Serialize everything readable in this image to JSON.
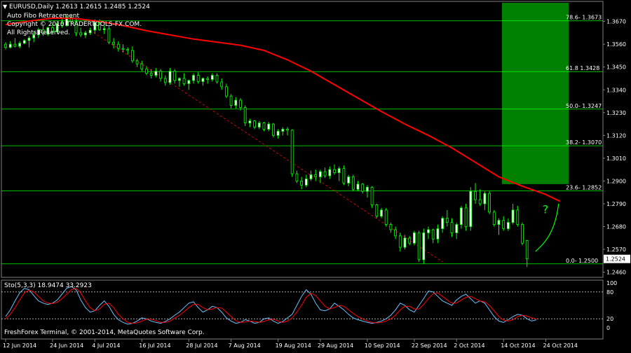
{
  "header": {
    "symbol_line": "EURUSD,Daily  1.2613 1.2615 1.2485 1.2524",
    "indicator": "Auto Fibo Retracement",
    "copyright": "Copyright © 2010 TRADERTOOLS-FX.COM.",
    "rights": "All Rights Reserved."
  },
  "footer": {
    "text": "FreshForex Terminal, © 2001-2014, MetaQuotes Software Corp."
  },
  "colors": {
    "bg": "#000000",
    "bull": "#ffffff",
    "bear": "#00ff00",
    "ma": "#ff0000",
    "fibo": "#00ff00",
    "zone": "#008000",
    "trend": "#ff0000",
    "sto_main": "#6cc3ff",
    "sto_signal": "#ff0000",
    "grid_text": "#ffffff"
  },
  "chart_data": [
    {
      "type": "candlestick",
      "title": "EURUSD,Daily",
      "ohlc_header": [
        1.2613,
        1.2615,
        1.2485,
        1.2524
      ],
      "ylim": [
        1.2435,
        1.376
      ],
      "y_ticks": [
        "1.3670",
        "1.3560",
        "1.3450",
        "1.3340",
        "1.3230",
        "1.3120",
        "1.3010",
        "1.2900",
        "1.2790",
        "1.2680",
        "1.2570",
        "1.2460"
      ],
      "x_tick_labels": [
        "12 Jun 2014",
        "24 Jun 2014",
        "4 Jul 2014",
        "16 Jul 2014",
        "28 Jul 2014",
        "7 Aug 2014",
        "19 Aug 2014",
        "29 Aug 2014",
        "10 Sep 2014",
        "22 Sep 2014",
        "2 Oct 2014",
        "14 Oct 2014",
        "24 Oct 2014"
      ],
      "x_tick_index": [
        0,
        10,
        19,
        29,
        39,
        48,
        58,
        67,
        77,
        87,
        96,
        106,
        115
      ],
      "current_price": "1.2524",
      "candles": [
        [
          1.356,
          1.357,
          1.3535,
          1.3545
        ],
        [
          1.3545,
          1.3575,
          1.354,
          1.356
        ],
        [
          1.356,
          1.359,
          1.3545,
          1.355
        ],
        [
          1.355,
          1.3575,
          1.354,
          1.3565
        ],
        [
          1.3565,
          1.3585,
          1.356,
          1.3578
        ],
        [
          1.3578,
          1.36,
          1.3545,
          1.359
        ],
        [
          1.359,
          1.362,
          1.357,
          1.3605
        ],
        [
          1.3605,
          1.364,
          1.359,
          1.363
        ],
        [
          1.363,
          1.365,
          1.36,
          1.361
        ],
        [
          1.361,
          1.3645,
          1.36,
          1.364
        ],
        [
          1.364,
          1.366,
          1.361,
          1.362
        ],
        [
          1.362,
          1.367,
          1.361,
          1.366
        ],
        [
          1.366,
          1.369,
          1.364,
          1.365
        ],
        [
          1.365,
          1.37,
          1.3645,
          1.369
        ],
        [
          1.369,
          1.37,
          1.366,
          1.367
        ],
        [
          1.367,
          1.368,
          1.36,
          1.3615
        ],
        [
          1.3615,
          1.364,
          1.3595,
          1.3605
        ],
        [
          1.3605,
          1.3625,
          1.359,
          1.3615
        ],
        [
          1.3615,
          1.364,
          1.3605,
          1.3628
        ],
        [
          1.3628,
          1.368,
          1.361,
          1.3665
        ],
        [
          1.3665,
          1.368,
          1.3625,
          1.363
        ],
        [
          1.363,
          1.365,
          1.361,
          1.3635
        ],
        [
          1.3635,
          1.365,
          1.356,
          1.357
        ],
        [
          1.357,
          1.359,
          1.354,
          1.356
        ],
        [
          1.356,
          1.3575,
          1.3525,
          1.354
        ],
        [
          1.354,
          1.356,
          1.352,
          1.3535
        ],
        [
          1.3535,
          1.3545,
          1.351,
          1.353
        ],
        [
          1.353,
          1.355,
          1.347,
          1.348
        ],
        [
          1.348,
          1.349,
          1.345,
          1.3465
        ],
        [
          1.3465,
          1.348,
          1.343,
          1.344
        ],
        [
          1.344,
          1.3455,
          1.341,
          1.342
        ],
        [
          1.342,
          1.344,
          1.3395,
          1.341
        ],
        [
          1.341,
          1.3445,
          1.34,
          1.343
        ],
        [
          1.343,
          1.344,
          1.338,
          1.3395
        ],
        [
          1.3395,
          1.341,
          1.336,
          1.3375
        ],
        [
          1.3375,
          1.3445,
          1.3365,
          1.343
        ],
        [
          1.343,
          1.344,
          1.337,
          1.3385
        ],
        [
          1.3385,
          1.34,
          1.3355,
          1.3395
        ],
        [
          1.3395,
          1.342,
          1.336,
          1.337
        ],
        [
          1.337,
          1.339,
          1.334,
          1.3385
        ],
        [
          1.3385,
          1.342,
          1.337,
          1.341
        ],
        [
          1.341,
          1.3425,
          1.337,
          1.338
        ],
        [
          1.338,
          1.34,
          1.336,
          1.3395
        ],
        [
          1.3395,
          1.3405,
          1.337,
          1.339
        ],
        [
          1.339,
          1.342,
          1.338,
          1.341
        ],
        [
          1.341,
          1.342,
          1.337,
          1.3378
        ],
        [
          1.3378,
          1.3395,
          1.334,
          1.3355
        ],
        [
          1.3355,
          1.337,
          1.33,
          1.331
        ],
        [
          1.331,
          1.332,
          1.325,
          1.3265
        ],
        [
          1.3265,
          1.3305,
          1.325,
          1.329
        ],
        [
          1.329,
          1.33,
          1.324,
          1.3255
        ],
        [
          1.3255,
          1.3265,
          1.3165,
          1.318
        ],
        [
          1.318,
          1.32,
          1.316,
          1.319
        ],
        [
          1.319,
          1.3195,
          1.315,
          1.316
        ],
        [
          1.316,
          1.319,
          1.315,
          1.318
        ],
        [
          1.318,
          1.3185,
          1.314,
          1.315
        ],
        [
          1.315,
          1.3185,
          1.314,
          1.3175
        ],
        [
          1.3175,
          1.318,
          1.311,
          1.312
        ],
        [
          1.312,
          1.315,
          1.3105,
          1.314
        ],
        [
          1.314,
          1.316,
          1.312,
          1.315
        ],
        [
          1.315,
          1.316,
          1.312,
          1.3145
        ],
        [
          1.3145,
          1.315,
          1.292,
          1.2935
        ],
        [
          1.2935,
          1.295,
          1.289,
          1.29
        ],
        [
          1.29,
          1.292,
          1.286,
          1.288
        ],
        [
          1.288,
          1.293,
          1.287,
          1.291
        ],
        [
          1.291,
          1.295,
          1.29,
          1.293
        ],
        [
          1.293,
          1.2955,
          1.29,
          1.292
        ],
        [
          1.292,
          1.2955,
          1.289,
          1.2945
        ],
        [
          1.2945,
          1.2965,
          1.2915,
          1.2925
        ],
        [
          1.2925,
          1.297,
          1.291,
          1.2955
        ],
        [
          1.2955,
          1.298,
          1.293,
          1.294
        ],
        [
          1.294,
          1.297,
          1.29,
          1.296
        ],
        [
          1.296,
          1.2975,
          1.288,
          1.289
        ],
        [
          1.289,
          1.293,
          1.2875,
          1.292
        ],
        [
          1.292,
          1.293,
          1.285,
          1.286
        ],
        [
          1.286,
          1.29,
          1.285,
          1.2885
        ],
        [
          1.2885,
          1.289,
          1.284,
          1.285
        ],
        [
          1.285,
          1.288,
          1.282,
          1.287
        ],
        [
          1.287,
          1.2875,
          1.277,
          1.2785
        ],
        [
          1.2785,
          1.279,
          1.272,
          1.273
        ],
        [
          1.273,
          1.277,
          1.272,
          1.276
        ],
        [
          1.276,
          1.277,
          1.268,
          1.269
        ],
        [
          1.269,
          1.27,
          1.265,
          1.2665
        ],
        [
          1.2665,
          1.268,
          1.262,
          1.2635
        ],
        [
          1.2635,
          1.265,
          1.256,
          1.258
        ],
        [
          1.258,
          1.264,
          1.257,
          1.2625
        ],
        [
          1.2625,
          1.2635,
          1.259,
          1.26
        ],
        [
          1.26,
          1.266,
          1.259,
          1.265
        ],
        [
          1.265,
          1.266,
          1.251,
          1.252
        ],
        [
          1.252,
          1.267,
          1.25,
          1.265
        ],
        [
          1.265,
          1.268,
          1.262,
          1.2665
        ],
        [
          1.2665,
          1.267,
          1.26,
          1.262
        ],
        [
          1.262,
          1.269,
          1.26,
          1.267
        ],
        [
          1.267,
          1.273,
          1.265,
          1.272
        ],
        [
          1.272,
          1.276,
          1.268,
          1.27
        ],
        [
          1.27,
          1.272,
          1.263,
          1.265
        ],
        [
          1.265,
          1.27,
          1.262,
          1.269
        ],
        [
          1.269,
          1.278,
          1.267,
          1.277
        ],
        [
          1.277,
          1.279,
          1.266,
          1.268
        ],
        [
          1.268,
          1.287,
          1.266,
          1.285
        ],
        [
          1.285,
          1.289,
          1.279,
          1.281
        ],
        [
          1.281,
          1.286,
          1.278,
          1.279
        ],
        [
          1.279,
          1.285,
          1.276,
          1.284
        ],
        [
          1.284,
          1.285,
          1.274,
          1.275
        ],
        [
          1.275,
          1.276,
          1.268,
          1.269
        ],
        [
          1.269,
          1.272,
          1.264,
          1.271
        ],
        [
          1.271,
          1.273,
          1.266,
          1.267
        ],
        [
          1.267,
          1.272,
          1.266,
          1.27
        ],
        [
          1.27,
          1.279,
          1.269,
          1.276
        ],
        [
          1.276,
          1.278,
          1.268,
          1.269
        ],
        [
          1.269,
          1.27,
          1.259,
          1.26
        ],
        [
          1.2613,
          1.2615,
          1.2485,
          1.2524
        ]
      ],
      "ma_line": [
        [
          0,
          1.3655
        ],
        [
          5,
          1.3672
        ],
        [
          10,
          1.3686
        ],
        [
          15,
          1.3684
        ],
        [
          20,
          1.367
        ],
        [
          25,
          1.365
        ],
        [
          30,
          1.3625
        ],
        [
          40,
          1.3585
        ],
        [
          50,
          1.3555
        ],
        [
          55,
          1.353
        ],
        [
          60,
          1.3485
        ],
        [
          65,
          1.343
        ],
        [
          70,
          1.3365
        ],
        [
          75,
          1.33
        ],
        [
          80,
          1.3235
        ],
        [
          85,
          1.3175
        ],
        [
          90,
          1.312
        ],
        [
          95,
          1.306
        ],
        [
          100,
          1.299
        ],
        [
          105,
          1.292
        ],
        [
          110,
          1.2875
        ],
        [
          115,
          1.2835
        ],
        [
          118,
          1.2802
        ]
      ],
      "trendline": [
        [
          18,
          1.3628
        ],
        [
          93,
          1.251
        ]
      ],
      "fibo_levels": [
        {
          "label": "78.6- 1.3673",
          "value": 1.3673
        },
        {
          "label": "61.8 1.3428",
          "value": 1.3428
        },
        {
          "label": "50.0- 1.3247",
          "value": 1.3247
        },
        {
          "label": "38.2- 1.3070",
          "value": 1.307
        },
        {
          "label": "23.6- 1.2852",
          "value": 1.2852
        },
        {
          "label": "0.0- 1.2500",
          "value": 1.25
        }
      ],
      "fibo_zone": {
        "top": 1.376,
        "bottom": 1.2885
      },
      "projection_label": "?"
    },
    {
      "type": "line",
      "title": "Sto(5,3,3) 18.9474 33.2923",
      "ylim": [
        0,
        100
      ],
      "y_ticks": [
        "100",
        "80",
        "20",
        "0"
      ],
      "levels": [
        80,
        20
      ],
      "series": [
        {
          "name": "main",
          "values": [
            25,
            40,
            60,
            78,
            88,
            85,
            72,
            60,
            55,
            52,
            55,
            62,
            75,
            88,
            92,
            85,
            62,
            45,
            35,
            38,
            50,
            60,
            48,
            30,
            18,
            12,
            8,
            10,
            15,
            22,
            20,
            15,
            12,
            10,
            14,
            20,
            28,
            35,
            45,
            55,
            58,
            45,
            35,
            40,
            48,
            45,
            35,
            22,
            15,
            10,
            12,
            18,
            15,
            10,
            12,
            20,
            22,
            15,
            10,
            14,
            22,
            30,
            50,
            70,
            85,
            75,
            55,
            40,
            38,
            42,
            55,
            48,
            40,
            30,
            22,
            18,
            15,
            12,
            10,
            12,
            15,
            20,
            28,
            40,
            55,
            50,
            40,
            35,
            50,
            65,
            82,
            80,
            70,
            60,
            55,
            50,
            62,
            70,
            75,
            65,
            55,
            60,
            55,
            40,
            25,
            15,
            12,
            18,
            25,
            30,
            28,
            20,
            15,
            18
          ]
        },
        {
          "name": "signal",
          "values": [
            20,
            30,
            45,
            62,
            78,
            84,
            80,
            70,
            60,
            55,
            54,
            57,
            65,
            75,
            85,
            88,
            78,
            60,
            45,
            38,
            42,
            52,
            55,
            45,
            30,
            20,
            12,
            10,
            11,
            15,
            19,
            19,
            16,
            12,
            12,
            15,
            22,
            28,
            36,
            45,
            52,
            52,
            45,
            40,
            42,
            45,
            44,
            35,
            25,
            16,
            12,
            13,
            15,
            14,
            12,
            14,
            18,
            19,
            15,
            12,
            15,
            22,
            35,
            50,
            68,
            77,
            72,
            60,
            48,
            42,
            45,
            50,
            48,
            40,
            32,
            25,
            20,
            15,
            12,
            11,
            12,
            15,
            20,
            28,
            40,
            48,
            48,
            42,
            42,
            52,
            65,
            76,
            78,
            70,
            62,
            55,
            55,
            62,
            68,
            70,
            65,
            60,
            58,
            50,
            38,
            25,
            17,
            15,
            18,
            25,
            28,
            26,
            22,
            20
          ]
        }
      ]
    }
  ]
}
